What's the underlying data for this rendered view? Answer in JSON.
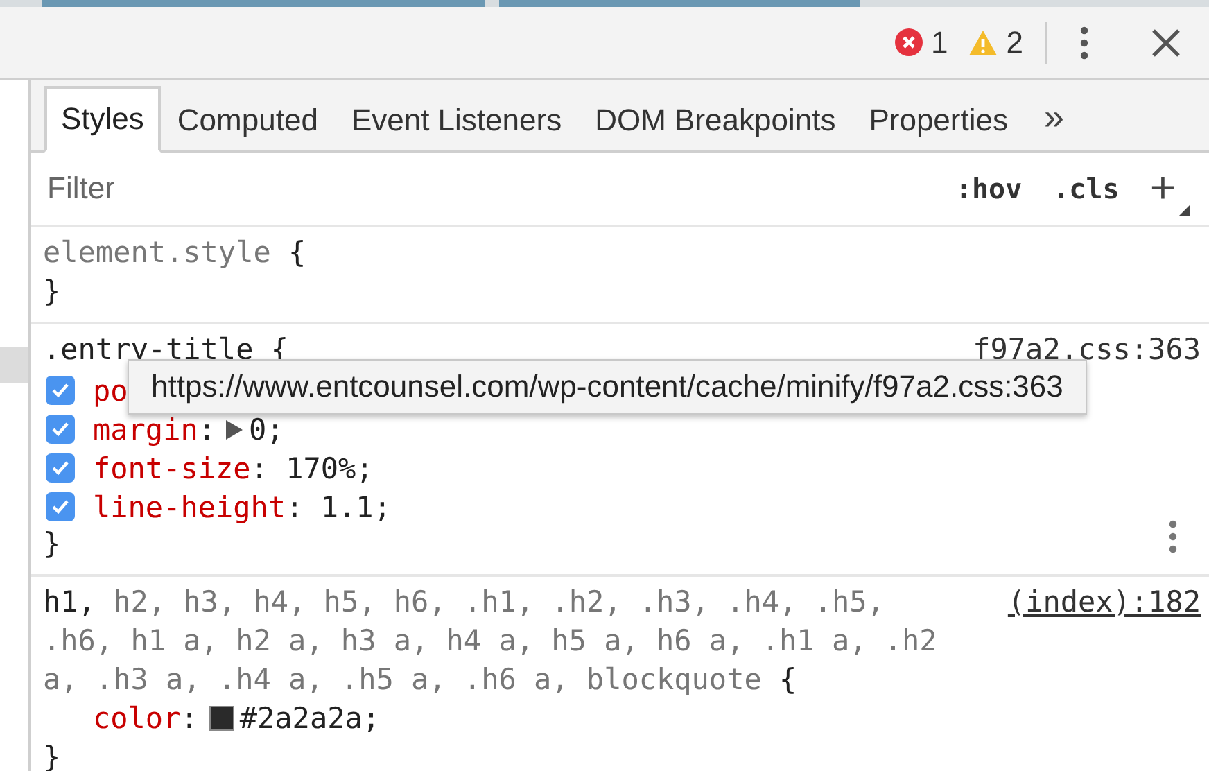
{
  "toolbar": {
    "errors": "1",
    "warnings": "2"
  },
  "tabs": [
    {
      "label": "Styles",
      "selected": true
    },
    {
      "label": "Computed",
      "selected": false
    },
    {
      "label": "Event Listeners",
      "selected": false
    },
    {
      "label": "DOM Breakpoints",
      "selected": false
    },
    {
      "label": "Properties",
      "selected": false
    }
  ],
  "more_tabs": "»",
  "filter": {
    "placeholder": "Filter",
    "hov": ":hov",
    "cls": ".cls",
    "add": "+"
  },
  "rules": [
    {
      "selector": [
        {
          "text": "element.style",
          "matched": false
        }
      ],
      "open": "{",
      "close": "}"
    },
    {
      "selector": [
        {
          "text": ".entry-title",
          "matched": true
        }
      ],
      "open": "{",
      "close": "}",
      "source": "f97a2.css:363",
      "underlined": false,
      "tooltip": "https://www.entcounsel.com/wp-content/cache/minify/f97a2.css:363",
      "show_menu": true,
      "declarations": [
        {
          "text": "po",
          "checked": true
        },
        {
          "text": "margin: 0;",
          "checked": true,
          "expandable": true
        },
        {
          "text": "font-size: 170%;",
          "checked": true
        },
        {
          "text": "line-height: 1.1;",
          "checked": true
        }
      ]
    },
    {
      "selector": [
        {
          "text": "h1,",
          "matched": true
        },
        {
          "text": "h2, h3, h4, h5, h6, .h1, .h2, .h3, .h4, .h5, .h6, h1 a, h2 a, h3 a, h4 a, h5 a, h6 a, .h1 a, .h2 a, .h3 a, .h4 a, .h5 a, .h6 a, blockquote",
          "matched": false
        }
      ],
      "open": "{",
      "close": "}",
      "source": "(index):182",
      "underlined": true,
      "declarations": [
        {
          "text": "color: #2a2a2a;",
          "kind": "color"
        }
      ]
    }
  ]
}
